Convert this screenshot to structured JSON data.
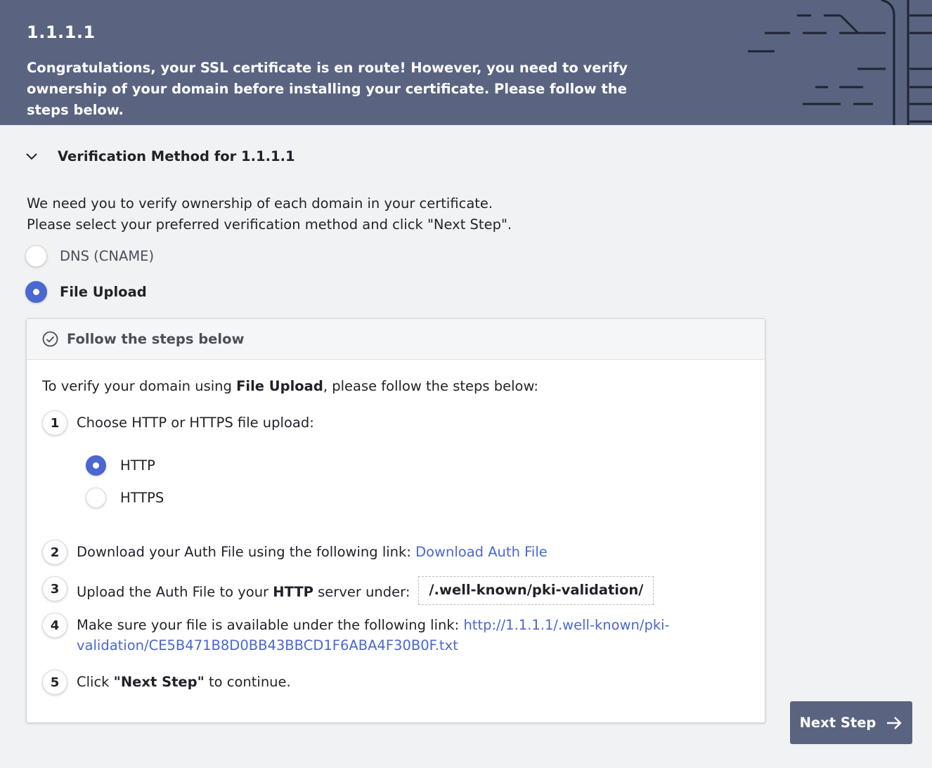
{
  "banner": {
    "title": "1.1.1.1",
    "message": "Congratulations, your SSL certificate is en route! However, you need to verify ownership of your domain before installing your certificate. Please follow the steps below."
  },
  "section": {
    "title": "Verification Method for 1.1.1.1",
    "icon": "chevron-down-icon"
  },
  "intro": {
    "line1": "We need you to verify ownership of each domain in your certificate.",
    "line2": "Please select your preferred verification method and click \"Next Step\"."
  },
  "methods": [
    {
      "label": "DNS (CNAME)",
      "selected": false
    },
    {
      "label": "File Upload",
      "selected": true
    }
  ],
  "panel": {
    "header": "Follow the steps below",
    "lead_prefix": "To verify your domain using ",
    "lead_method": "File Upload",
    "lead_suffix": ", please follow the steps below:",
    "steps": [
      {
        "num": "1",
        "text": "Choose HTTP or HTTPS file upload:"
      },
      {
        "num": "2",
        "text": "Download your Auth File using the following link: ",
        "link": "Download Auth File"
      },
      {
        "num": "3",
        "text_prefix": "Upload the Auth File to your ",
        "text_bold": "HTTP",
        "text_suffix": " server under:",
        "path": "/.well-known/pki-validation/"
      },
      {
        "num": "4",
        "text": "Make sure your file is available under the following link: ",
        "link_line1": "http://1.1.1.1/.well-known/pki-",
        "link_line2": "validation/CE5B471B8D0BB43BBCD1F6ABA4F30B0F.txt"
      },
      {
        "num": "5",
        "text_prefix": "Click ",
        "text_bold": "\"Next Step\"",
        "text_suffix": " to continue."
      }
    ],
    "protocols": [
      {
        "label": "HTTP",
        "selected": true
      },
      {
        "label": "HTTPS",
        "selected": false
      }
    ]
  },
  "next_button": {
    "label": "Next Step",
    "icon": "arrow-right-icon"
  },
  "colors": {
    "banner_bg": "#5a6481",
    "accent": "#4a67d2",
    "page_bg": "#f1f2f4"
  }
}
